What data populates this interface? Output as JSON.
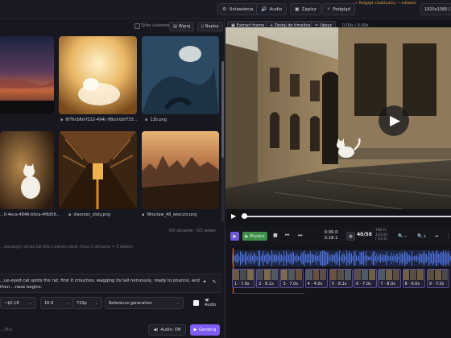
{
  "topbar": {
    "settings_label": "Ustawienia",
    "audio_label": "Audio",
    "save_label": "Zapisz",
    "preview_label": "Podgląd",
    "warning_text": "⚠ Podgląd nieaktualny — odśwież",
    "resolution": "1920x1080 (1"
  },
  "library": {
    "favorites_label": "Tylko ulubione",
    "upload_label": "Wgraj",
    "captions_label": "Napisy",
    "items": [
      {
        "name": ""
      },
      {
        "name": "6f76cb6d-f222-494c-98cd-bbf733..."
      },
      {
        "name": "12b.png"
      },
      {
        "name": "...0-4eca-4846-b0ca-4f6d56..."
      },
      {
        "name": "dworzec_zloty.png"
      },
      {
        "name": "Wroclaw_48_wieczor.png"
      }
    ],
    "count_text": "0/5 obrazów · 0/3 wideo",
    "hint_text": "...(zaczęgn) obraz lub klip z panelu obok (max 5 obrazów + 3 wideo)"
  },
  "prompt": {
    "text": "...ue-eyed cat spots the rat; first it crouches, wagging its tail nervously, ready to pounce, and then ...nase begins."
  },
  "settings": {
    "price": "~$0.18",
    "aspect": "16:9",
    "quality": "720p",
    "mode": "Reference generation",
    "audio_label": "Audio",
    "audio_button": "Audio: ON",
    "generate_label": "Generuj",
    "footer_left": "...34s)"
  },
  "video_toolbar": {
    "extract_label": "Extract frame",
    "add_label": "Dodaj do timeline",
    "trim_label": "Upsyc",
    "time_readout": "0.00s / 0.00s"
  },
  "timeline": {
    "physics_label": "Physics",
    "timecode_current": "0:00.0",
    "timecode_total": "3:18.1",
    "frame_label": "786 fs /",
    "frame_count": "40/58",
    "stats_1": "786 fs",
    "stats_2": "233.8s",
    "stats_3": "(-33.0)",
    "progress": 0.0,
    "clips": [
      {
        "label": "1 · 7.0s"
      },
      {
        "label": "2 · 8.1s"
      },
      {
        "label": "3 · 7.0s"
      },
      {
        "label": "4 · 4.0s"
      },
      {
        "label": "5 · 8.1s"
      },
      {
        "label": "6 · 7.0s"
      },
      {
        "label": "7 · 8.0s"
      },
      {
        "label": "8 · 6.0s"
      },
      {
        "label": "9 · 7.0s"
      }
    ]
  },
  "colors": {
    "accent": "#7f5cf2",
    "physics": "#3f8f4a",
    "warning": "#e8a23c",
    "cursor": "#ff6a2b"
  }
}
